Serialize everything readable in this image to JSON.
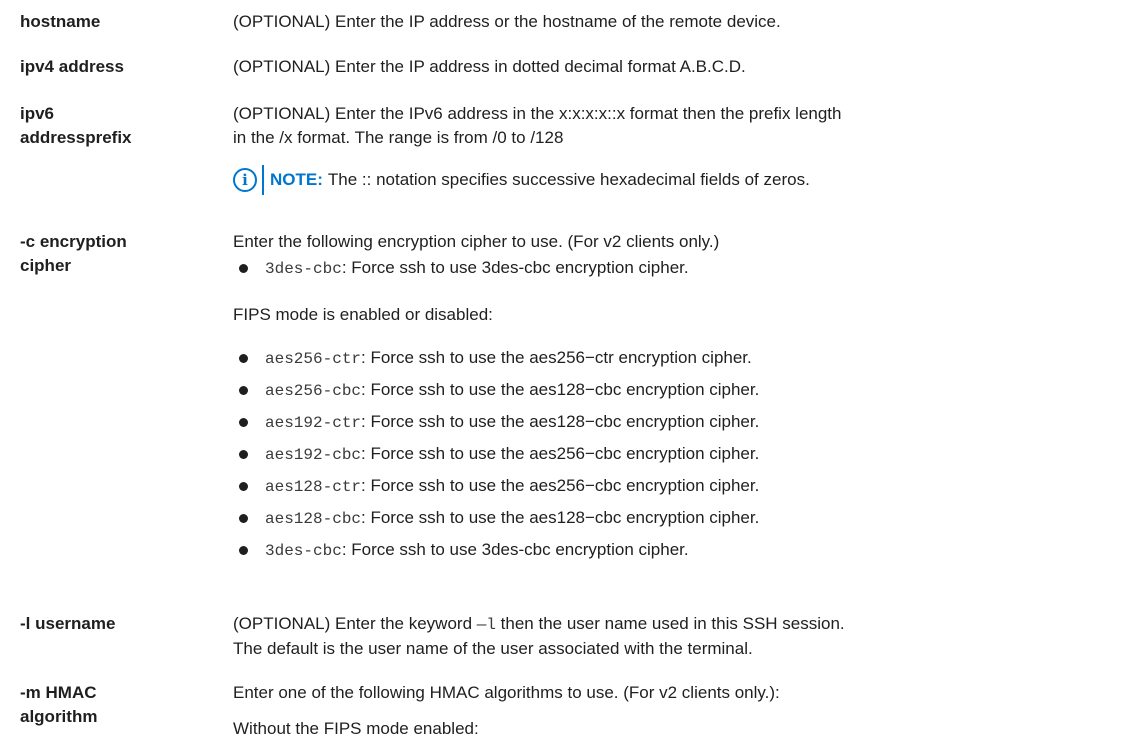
{
  "rows": {
    "hostname": {
      "term": "hostname",
      "desc": "(OPTIONAL) Enter the IP address or the hostname of the remote device."
    },
    "ipv4": {
      "term": "ipv4 address",
      "desc": "(OPTIONAL) Enter the IP address in dotted decimal format A.B.C.D."
    },
    "ipv6": {
      "term_line1": "ipv6",
      "term_line2": "addressprefix",
      "desc_line1": "(OPTIONAL) Enter the IPv6 address in the x:x:x:x::x format then the prefix length",
      "desc_line2": "in the /x format. The range is from /0 to /128",
      "note_icon": "i",
      "note_label": "NOTE:",
      "note_text": "The :: notation specifies successive hexadecimal fields of zeros."
    },
    "cipher": {
      "term_line1": "-c encryption",
      "term_line2": "cipher",
      "intro": "Enter the following encryption cipher to use. (For v2 clients only.)",
      "first_item": {
        "code": "3des-cbc",
        "text": ": Force ssh to use 3des-cbc encryption cipher."
      },
      "fips_text": "FIPS mode is enabled or disabled:",
      "items": [
        {
          "code": "aes256-ctr",
          "text": ": Force ssh to use the aes256−ctr encryption cipher."
        },
        {
          "code": "aes256-cbc",
          "text": ": Force ssh to use the aes128−cbc encryption cipher."
        },
        {
          "code": "aes192-ctr",
          "text": ": Force ssh to use the aes128−cbc encryption cipher."
        },
        {
          "code": "aes192-cbc",
          "text": ": Force ssh to use the aes256−cbc encryption cipher."
        },
        {
          "code": "aes128-ctr",
          "text": ": Force ssh to use the aes256−cbc encryption cipher."
        },
        {
          "code": "aes128-cbc",
          "text": ": Force ssh to use the aes128−cbc encryption cipher."
        },
        {
          "code": "3des-cbc",
          "text": ": Force ssh to use 3des-cbc encryption cipher."
        }
      ]
    },
    "username": {
      "term": "-l username",
      "desc_pre": "(OPTIONAL) Enter the keyword ",
      "desc_code": "—l",
      "desc_post": " then the user name used in this SSH session.",
      "desc_line2": "The default is the user name of the user associated with the terminal."
    },
    "hmac": {
      "term_line1": "-m HMAC",
      "term_line2": "algorithm",
      "desc_line1": "Enter one of the following HMAC algorithms to use. (For v2 clients only.):",
      "desc_line2": "Without the FIPS mode enabled:"
    }
  }
}
